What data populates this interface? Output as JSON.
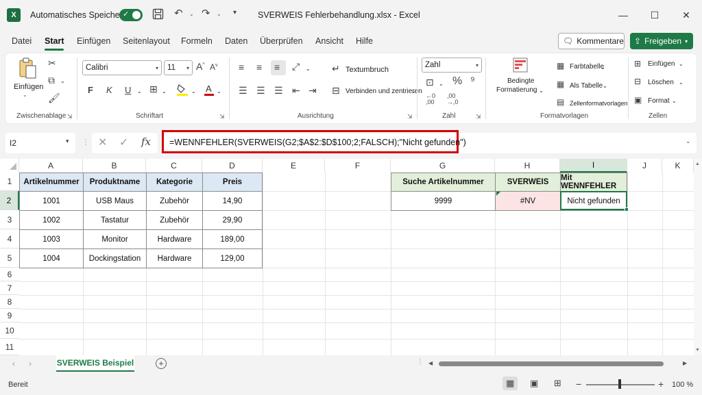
{
  "titlebar": {
    "logo": "X",
    "autosave_label": "Automatisches Speichern",
    "filename": "SVERWEIS Fehlerbehandlung.xlsx",
    "app_separator": "-",
    "app_name": "Excel"
  },
  "menu": {
    "tabs": [
      "Datei",
      "Start",
      "Einfügen",
      "Seitenlayout",
      "Formeln",
      "Daten",
      "Überprüfen",
      "Ansicht",
      "Hilfe"
    ],
    "active": "Start",
    "comments_label": "Kommentare",
    "share_label": "Freigeben"
  },
  "ribbon": {
    "paste_label": "Einfügen",
    "group_clipboard": "Zwischenablage",
    "font_name": "Calibri",
    "font_size": "11",
    "bold": "F",
    "italic": "K",
    "underline": "U",
    "group_font": "Schriftart",
    "wrap_text": "Textumbruch",
    "merge_center": "Verbinden und zentrieren",
    "group_alignment": "Ausrichtung",
    "number_format": "Zahl",
    "group_number": "Zahl",
    "cond_format_line1": "Bedingte",
    "cond_format_line2": "Formatierung",
    "cell_color": "Farbtabelle",
    "as_table": "Als Tabelle",
    "cell_styles": "Zellenformatvorlagen",
    "group_styles": "Formatvorlagen",
    "insert": "Einfügen",
    "delete": "Löschen",
    "format": "Format",
    "group_cells": "Zellen"
  },
  "formula_bar": {
    "name_box": "I2",
    "fx": "fx",
    "formula": "=WENNFEHLER(SVERWEIS(G2;$A$2:$D$100;2;FALSCH);\"Nicht gefunden\")"
  },
  "grid": {
    "columns": [
      "A",
      "B",
      "C",
      "D",
      "E",
      "F",
      "G",
      "H",
      "I",
      "J",
      "K"
    ],
    "rows": [
      "1",
      "2",
      "3",
      "4",
      "5",
      "6",
      "7",
      "8",
      "9",
      "10",
      "11"
    ],
    "table_headers": [
      "Artikelnummer",
      "Produktname",
      "Kategorie",
      "Preis"
    ],
    "table_rows": [
      [
        "1001",
        "USB Maus",
        "Zubehör",
        "14,90"
      ],
      [
        "1002",
        "Tastatur",
        "Zubehör",
        "29,90"
      ],
      [
        "1003",
        "Monitor",
        "Hardware",
        "189,00"
      ],
      [
        "1004",
        "Dockingstation",
        "Hardware",
        "129,00"
      ]
    ],
    "lookup_headers": [
      "Suche Artikelnummer",
      "SVERWEIS",
      "Mit WENNFEHLER"
    ],
    "lookup_values": [
      "9999",
      "#NV",
      "Nicht gefunden"
    ]
  },
  "sheets": {
    "active": "SVERWEIS Beispiel"
  },
  "status": {
    "ready": "Bereit",
    "zoom": "100 %"
  },
  "colors": {
    "accent": "#1e7a46",
    "header_fill": "#dde8f5",
    "lookup_header_fill": "#e2efda",
    "error_fill": "#fce4e4",
    "highlight": "#d10000"
  }
}
